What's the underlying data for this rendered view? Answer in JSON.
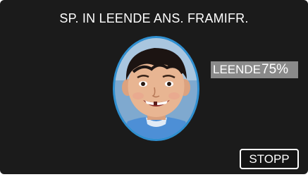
{
  "screen": {
    "title": "SP. IN LEENDE ANS. FRAMIFR.",
    "frame_color": "#2f8fd0",
    "background_color": "#1b1b1b"
  },
  "face_preview": {
    "icon": "child-face-portrait"
  },
  "progress": {
    "label": "LEENDE",
    "value_text": "75%",
    "fraction": 0.75
  },
  "stop_button": {
    "label": "STOPP"
  }
}
